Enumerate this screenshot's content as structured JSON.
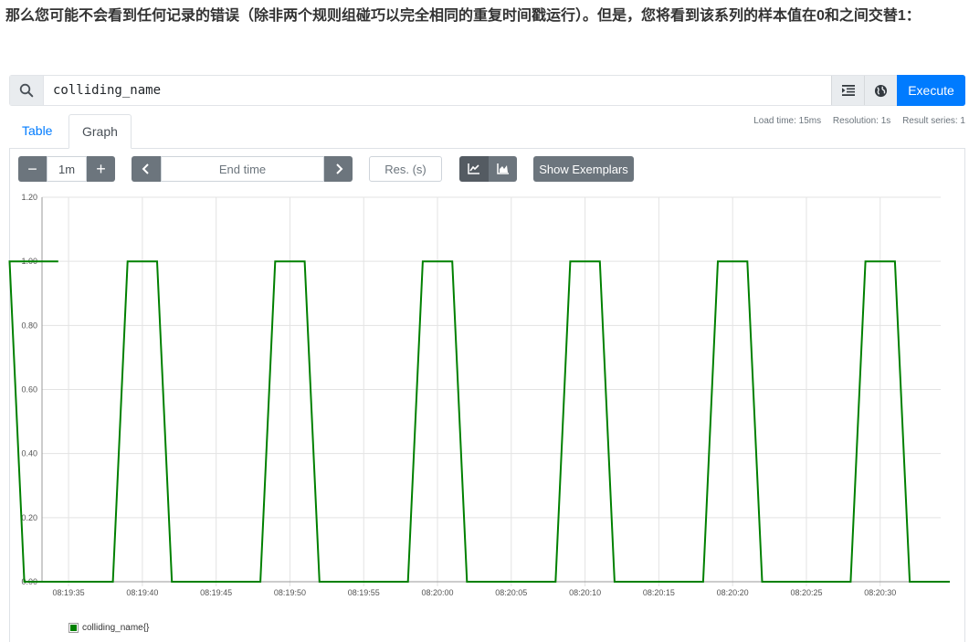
{
  "heading": "那么您可能不会看到任何记录的错误（除非两个规则组碰巧以完全相同的重复时间戳运行）。但是，您将看到该系列的样本值在0和之间交替1：",
  "query": {
    "value": "colliding_name",
    "execute_label": "Execute"
  },
  "stats": {
    "load_time": "Load time: 15ms",
    "resolution": "Resolution: 1s",
    "result_series": "Result series: 1"
  },
  "tabs": [
    {
      "label": "Table",
      "active": false
    },
    {
      "label": "Graph",
      "active": true
    }
  ],
  "controls": {
    "minus": "−",
    "range": "1m",
    "plus": "+",
    "end_time_placeholder": "End time",
    "resolution_placeholder": "Res. (s)",
    "show_exemplars": "Show Exemplars"
  },
  "colors": {
    "series": "#008000",
    "accent": "#007bff"
  },
  "chart_data": {
    "type": "line",
    "series": [
      {
        "name": "colliding_name{}",
        "color": "#008000",
        "pattern": {
          "high_start_seconds": [
            -1,
            9,
            19,
            29,
            39,
            49,
            59,
            69,
            79,
            89,
            99,
            109
          ],
          "high_duration_seconds": 2,
          "ramp_seconds": 1,
          "value_high": 1,
          "value_low": 0
        }
      }
    ],
    "x_ticks": [
      "08:19:35",
      "08:19:40",
      "08:19:45",
      "08:19:50",
      "08:19:55",
      "08:20:00",
      "08:20:05",
      "08:20:10",
      "08:20:15",
      "08:20:20",
      "08:20:25",
      "08:20:30"
    ],
    "x_tick_seconds": [
      5,
      10,
      15,
      20,
      25,
      30,
      35,
      40,
      45,
      50,
      55,
      60
    ],
    "xlim_seconds": [
      3.2,
      64.1
    ],
    "y_ticks": [
      "0.00",
      "0.20",
      "0.40",
      "0.60",
      "0.80",
      "1.00",
      "1.20"
    ],
    "ylim": [
      0,
      1.2
    ],
    "grid": true
  }
}
